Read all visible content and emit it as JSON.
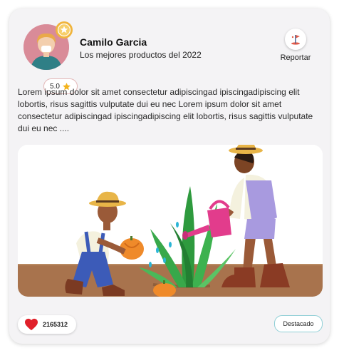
{
  "profile": {
    "name": "Camilo Garcia",
    "subtitle": "Los mejores productos del 2022",
    "rating": "5.0",
    "avatar_icon": "user-avatar",
    "medal_icon": "award-medal-icon"
  },
  "actions": {
    "report_label": "Reportar",
    "report_icon": "report-flag-icon"
  },
  "post": {
    "text": "Lorem ipsum dolor sit amet consectetur adipiscingad ipiscingadipiscing elit lobortis, risus sagittis vulputate dui eu nec Lorem ipsum dolor sit amet consectetur adipiscingad ipiscingadipiscing elit lobortis, risus sagittis vulputate dui eu nec ....",
    "image_icon": "gardening-illustration"
  },
  "footer": {
    "likes_count": "2165312",
    "like_icon": "heart-icon",
    "badge_label": "Destacado"
  },
  "colors": {
    "card_bg": "#f4f3f5",
    "heart": "#e0202a",
    "badge_border": "#8fcfd6",
    "avatar_bg": "#d98b98"
  }
}
